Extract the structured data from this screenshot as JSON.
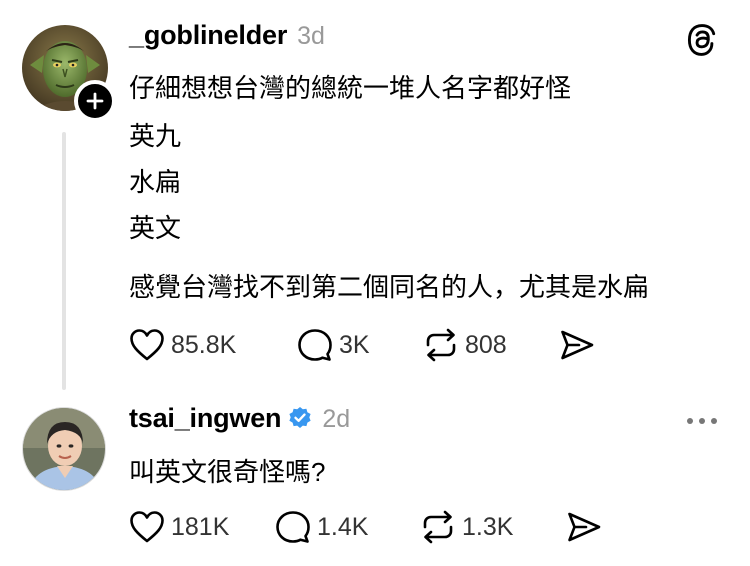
{
  "post1": {
    "username": "_goblinelder",
    "time": "3d",
    "lines": [
      "仔細想想台灣的總統一堆人名字都好怪",
      "英九",
      "水扁",
      "英文",
      "感覺台灣找不到第二個同名的人，尤其是水扁"
    ],
    "likes": "85.8K",
    "replies": "3K",
    "reposts": "808"
  },
  "post2": {
    "username": "tsai_ingwen",
    "time": "2d",
    "text": "叫英文很奇怪嗎?",
    "likes": "181K",
    "replies": "1.4K",
    "reposts": "1.3K"
  },
  "icons": {
    "logo": "threads-logo-icon",
    "like": "heart-icon",
    "reply": "speech-bubble-icon",
    "repost": "repost-icon",
    "share": "send-icon",
    "follow": "plus-icon",
    "verified": "verified-badge-icon",
    "more": "more-options-icon"
  },
  "colors": {
    "verified": "#3897f0",
    "muted": "#999999"
  }
}
